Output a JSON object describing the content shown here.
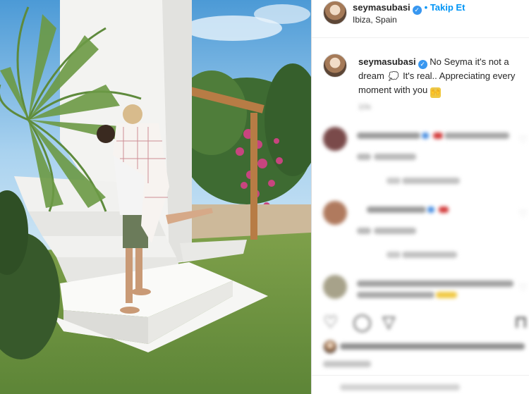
{
  "post": {
    "username": "seymasubasi",
    "verified_mark": "✓",
    "follow_label": "• Takip Et",
    "location": "Ibiza, Spain",
    "caption_username": "seymasubasi",
    "caption_part1": "No Seyma it's not a dream",
    "caption_emoji_dream": "💭",
    "caption_part2": "It's real.. Appreciating every moment with you",
    "caption_emoji_hug": "🙌",
    "caption_time": "10s"
  },
  "comments_blurred": true,
  "icons": {
    "like": "heart-icon",
    "comment": "comment-icon",
    "share": "share-icon",
    "save": "bookmark-icon",
    "heart_glyph": "♡",
    "comment_glyph": "◯",
    "share_glyph": "▽",
    "save_glyph": "⊓"
  },
  "colors": {
    "link_blue": "#0095f6",
    "verified_blue": "#3897f0",
    "muted_text": "#8e8e8e"
  }
}
